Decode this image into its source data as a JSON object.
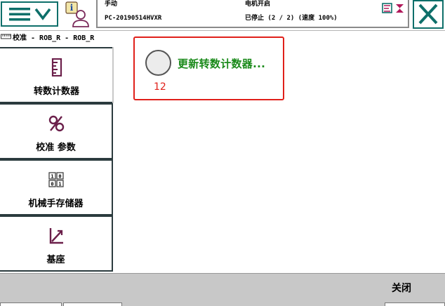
{
  "header": {
    "menu_icon": "menu-hamburger-chevron-icon",
    "status_icon": "operator-info-icon",
    "mode": "手动",
    "controller": "PC-20190514HVXR",
    "motor_state": "电机开启",
    "run_state": "已停止 (2 / 2) (速度 100%)",
    "close_icon": "close-x-icon"
  },
  "breadcrumb": {
    "icon": "calibration-ruler-icon",
    "text": "校准 - ROB_R - ROB_R"
  },
  "sidebar": {
    "items": [
      {
        "label": "转数计数器",
        "icon": "rev-counter-icon"
      },
      {
        "label": "校准 参数",
        "icon": "calibration-params-icon"
      },
      {
        "label": "机械手存储器",
        "icon": "robot-memory-icon"
      },
      {
        "label": "基座",
        "icon": "base-frame-icon"
      }
    ]
  },
  "content": {
    "option_label": "更新转数计数器...",
    "annotation": "12"
  },
  "footer": {
    "close_label": "关闭"
  },
  "colors": {
    "accent": "#0e6f6a",
    "option_text": "#1a8a1a",
    "highlight": "#e0201a",
    "footer_bg": "#c8c8c8"
  }
}
